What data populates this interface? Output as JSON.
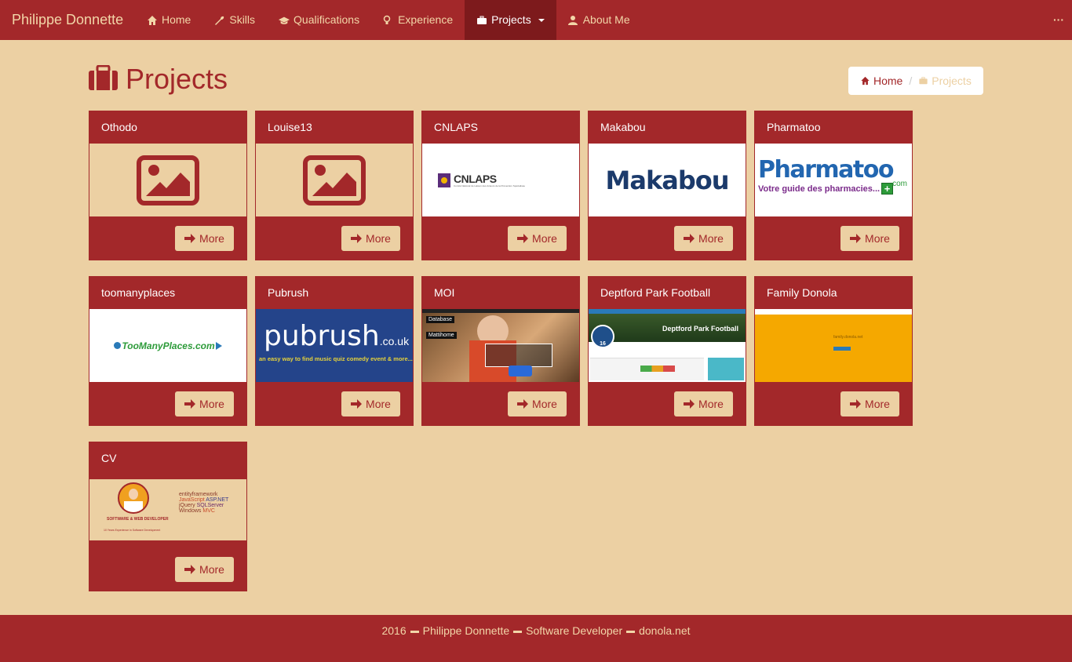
{
  "navbar": {
    "brand": "Philippe Donnette",
    "items": [
      {
        "label": "Home",
        "icon": "home-icon"
      },
      {
        "label": "Skills",
        "icon": "wrench-icon"
      },
      {
        "label": "Qualifications",
        "icon": "graduation-cap-icon"
      },
      {
        "label": "Experience",
        "icon": "lightbulb-icon"
      },
      {
        "label": "Projects",
        "icon": "briefcase-icon",
        "active": true
      },
      {
        "label": "About Me",
        "icon": "user-icon"
      }
    ],
    "menu_dots": "···"
  },
  "page": {
    "title": "Projects",
    "breadcrumb": {
      "home": "Home",
      "current": "Projects"
    }
  },
  "projects": [
    {
      "title": "Othodo",
      "image": "placeholder-image-icon",
      "more": "More"
    },
    {
      "title": "Louise13",
      "image": "placeholder-image-icon",
      "more": "More"
    },
    {
      "title": "CNLAPS",
      "image": "cnlaps-logo",
      "more": "More"
    },
    {
      "title": "Makabou",
      "image": "makabou-logo",
      "more": "More"
    },
    {
      "title": "Pharmatoo",
      "image": "pharmatoo-logo",
      "more": "More"
    },
    {
      "title": "toomanyplaces",
      "image": "toomanyplaces-logo",
      "more": "More"
    },
    {
      "title": "Pubrush",
      "image": "pubrush-logo",
      "more": "More"
    },
    {
      "title": "MOI",
      "image": "moi-screenshot",
      "more": "More"
    },
    {
      "title": "Deptford Park Football",
      "image": "deptford-screenshot",
      "more": "More"
    },
    {
      "title": "Family Donola",
      "image": "family-donola-screenshot",
      "more": "More"
    },
    {
      "title": "CV",
      "image": "cv-screenshot",
      "more": "More"
    }
  ],
  "logos": {
    "cnlaps": {
      "name": "CNLAPS",
      "sub": "Comité National de Liaison des Acteurs de la Prévention Spécialisée"
    },
    "makabou": "Makabou",
    "pharmatoo": {
      "name": "Pharmatoo",
      "com": ".com",
      "tagline": "Votre guide des pharmacies..."
    },
    "toomanyplaces": "TooManyPlaces.com",
    "pubrush": {
      "name": "pubrush",
      "tld": ".co.uk",
      "tagline": "an easy way to find music quiz comedy event & more..."
    },
    "moi": {
      "label1": "Database",
      "label2": "Mattihome"
    },
    "deptford": {
      "title": "Deptford Park Football",
      "badge": "16"
    },
    "family": {
      "domain": "family.donola.net"
    },
    "cv": {
      "role": "SOFTWARE & WEB DEVELOPER",
      "sub": "10 Years Experience in Software Development",
      "words": [
        "entityframework",
        "JavaScript",
        "ASP.NET",
        "jQuery",
        "SQLServer",
        "Windows",
        "MVC",
        "CSS",
        "HTML"
      ]
    }
  },
  "footer": {
    "year": "2016",
    "name": "Philippe Donnette",
    "role": "Software Developer",
    "site": "donola.net"
  },
  "colors": {
    "accent": "#a3282a",
    "background": "#ecd0a3",
    "nav_active": "#7d1a1c"
  }
}
